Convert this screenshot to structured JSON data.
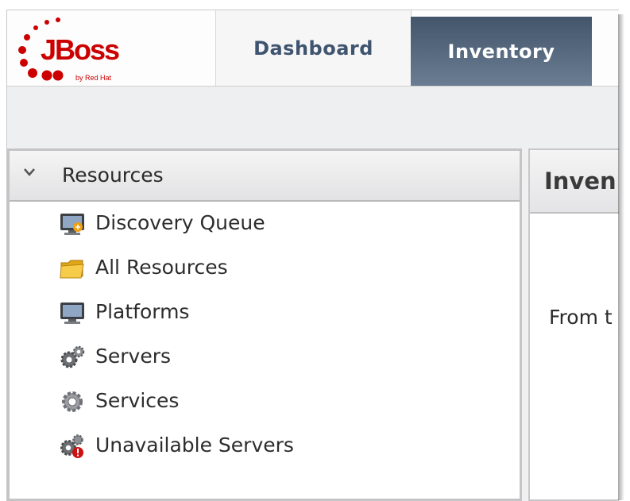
{
  "header": {
    "logo": {
      "wordmark": "JBoss",
      "tagline": "by Red Hat"
    },
    "tabs": [
      {
        "label": "Dashboard",
        "selected": false
      },
      {
        "label": "Inventory",
        "selected": true
      }
    ]
  },
  "left_panel": {
    "section_title": "Resources",
    "items": [
      {
        "label": "Discovery Queue",
        "icon": "discovery-queue-icon"
      },
      {
        "label": "All Resources",
        "icon": "folder-icon"
      },
      {
        "label": "Platforms",
        "icon": "monitor-icon"
      },
      {
        "label": "Servers",
        "icon": "gears-icon"
      },
      {
        "label": "Services",
        "icon": "gear-icon"
      },
      {
        "label": "Unavailable Servers",
        "icon": "unavailable-gears-icon"
      }
    ]
  },
  "right_panel": {
    "title": "Inven",
    "body_text": "From t"
  },
  "colors": {
    "active_tab": "#4e6075",
    "tab_text": "#3f546f",
    "logo_red": "#cc0000"
  }
}
